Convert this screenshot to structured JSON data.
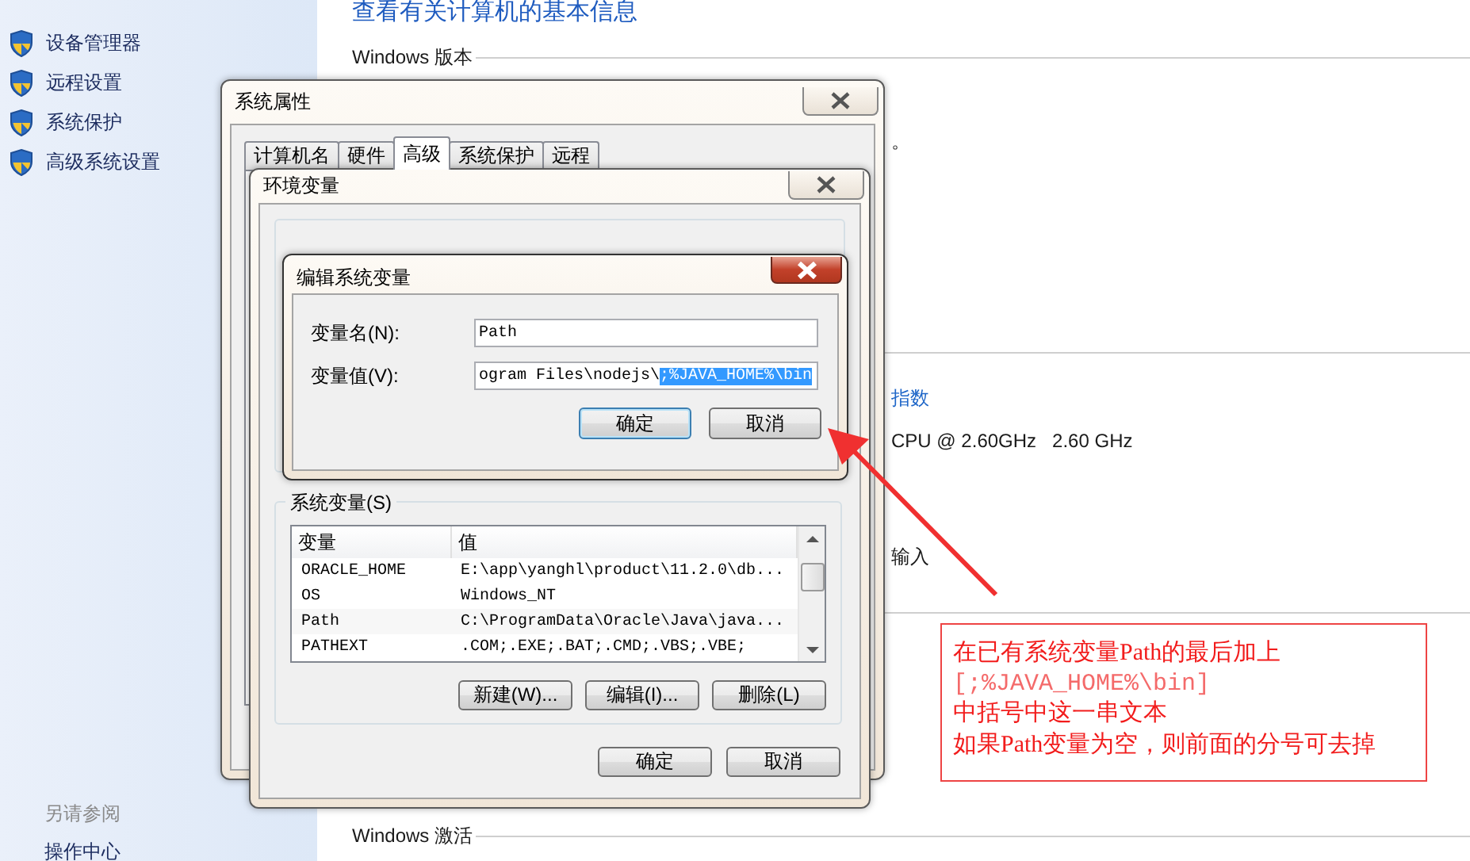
{
  "control_panel": {
    "title": "查看有关计算机的基本信息",
    "sidebar_links": [
      "设备管理器",
      "远程设置",
      "系统保护",
      "高级系统设置"
    ],
    "see_also": {
      "heading": "另请参阅",
      "links": [
        "操作中心"
      ]
    },
    "sections": [
      {
        "heading": "Windows 版本",
        "items": [
          {
            "kind": "text",
            "text": "。"
          }
        ]
      },
      {
        "items": [
          {
            "kind": "link",
            "text": "指数"
          },
          {
            "kind": "text",
            "text": "CPU @ 2.60GHz   2.60 GHz"
          },
          {
            "kind": "text",
            "text": "输入"
          }
        ]
      },
      {
        "heading": "Windows 激活"
      }
    ]
  },
  "system_properties": {
    "title": "系统属性",
    "tabs": [
      {
        "label": "计算机名",
        "selected": false
      },
      {
        "label": "硬件",
        "selected": false
      },
      {
        "label": "高级",
        "selected": true
      },
      {
        "label": "系统保护",
        "selected": false
      },
      {
        "label": "远程",
        "selected": false
      }
    ]
  },
  "environment_variables": {
    "title": "环境变量",
    "system_variables": {
      "label": "系统变量(S)",
      "columns": [
        "变量",
        "值"
      ],
      "rows": [
        [
          "ORACLE_HOME",
          "E:\\app\\yanghl\\product\\11.2.0\\db..."
        ],
        [
          "OS",
          "Windows_NT"
        ],
        [
          "Path",
          "C:\\ProgramData\\Oracle\\Java\\java..."
        ],
        [
          "PATHEXT",
          ".COM;.EXE;.BAT;.CMD;.VBS;.VBE;"
        ]
      ]
    },
    "list_buttons": [
      "新建(W)...",
      "编辑(I)...",
      "删除(L)"
    ],
    "buttons": [
      "确定",
      "取消"
    ]
  },
  "edit_dialog": {
    "title": "编辑系统变量",
    "fields": [
      {
        "label": "变量名(N):",
        "value": "Path"
      },
      {
        "label": "变量值(V):",
        "value": "ogram Files\\nodejs\\",
        "selected_text": ";%JAVA_HOME%\\bin"
      }
    ],
    "buttons": [
      {
        "label": "确定",
        "default": true
      },
      {
        "label": "取消",
        "default": false
      }
    ]
  },
  "annotation": {
    "lines": [
      {
        "kind": "note",
        "text": "在已有系统变量Path的最后加上"
      },
      {
        "kind": "code",
        "text": "[;%JAVA_HOME%\\bin]"
      },
      {
        "kind": "note",
        "text": "中括号中这一串文本"
      },
      {
        "kind": "note",
        "text": "如果Path变量为空，则前面的分号可去掉"
      }
    ]
  }
}
